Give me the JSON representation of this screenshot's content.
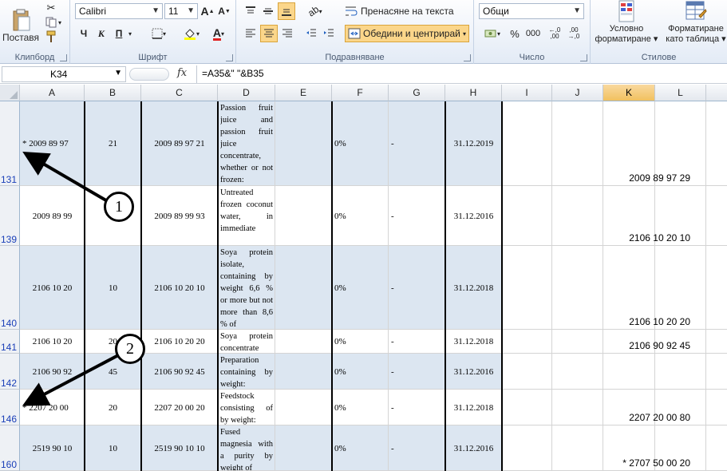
{
  "ribbon": {
    "clipboard": {
      "paste_label": "Поставя",
      "group_label": "Клипборд"
    },
    "font": {
      "name": "Calibri",
      "size": "11",
      "bold": "Ч",
      "italic": "К",
      "underline": "П",
      "group_label": "Шрифт"
    },
    "alignment": {
      "wrap_label": "Пренасяне на текста",
      "merge_label": "Обедини и центрирай",
      "group_label": "Подравняване"
    },
    "number": {
      "format": "Общи",
      "percent": "%",
      "thousands": "000",
      "group_label": "Число"
    },
    "styles": {
      "conditional_line1": "Условно",
      "conditional_line2": "форматиране",
      "table_line1": "Форматиране",
      "table_line2": "като таблица",
      "group_label": "Стилове"
    }
  },
  "formula_bar": {
    "cell_ref": "K34",
    "fx": "fx",
    "formula": "=A35&\" \"&B35"
  },
  "columns": [
    "A",
    "B",
    "C",
    "D",
    "E",
    "F",
    "G",
    "H",
    "I",
    "J",
    "K",
    "L"
  ],
  "rows": [
    {
      "num": "131",
      "a": "* 2009 89 97",
      "b": "21",
      "c": "2009 89 97 21",
      "d": "Passion fruit juice and passion fruit juice concentrate, whether or not frozen:",
      "f": "0%",
      "g": "-",
      "h": "31.12.2019",
      "k": "2009 89 97 29"
    },
    {
      "num": "139",
      "a": "2009 89 99",
      "b": "",
      "c": "2009 89 99 93",
      "d": "Untreated frozen coconut water, in immediate",
      "f": "0%",
      "g": "-",
      "h": "31.12.2016",
      "k": "2106 10 20 10"
    },
    {
      "num": "140",
      "a": "2106 10 20",
      "b": "10",
      "c": "2106 10 20 10",
      "d": "Soya protein isolate, containing by weight 6,6 % or more but not more than 8,6 % of",
      "f": "0%",
      "g": "-",
      "h": "31.12.2018",
      "k": "2106 10 20 20"
    },
    {
      "num": "141",
      "a": "2106 10 20",
      "b": "20",
      "c": "2106 10 20 20",
      "d": "Soya protein concentrate",
      "f": "0%",
      "g": "-",
      "h": "31.12.2018",
      "k": "2106 90 92 45"
    },
    {
      "num": "142",
      "a": "2106 90 92",
      "b": "45",
      "c": "2106 90 92 45",
      "d": "Preparation containing by weight:",
      "f": "0%",
      "g": "-",
      "h": "31.12.2016",
      "k": ""
    },
    {
      "num": "146",
      "a": "* 2207 20 00",
      "b": "20",
      "c": "2207 20 00 20",
      "d": " Feedstock consisting of by weight:",
      "f": "0%",
      "g": "-",
      "h": "31.12.2018",
      "k": "2207 20 00 80"
    },
    {
      "num": "160",
      "a": "2519 90 10",
      "b": "10",
      "c": "2519 90 10 10",
      "d": "Fused magnesia with a purity by weight of",
      "f": "0%",
      "g": "-",
      "h": "31.12.2016",
      "k": "* 2707 50 00 20"
    }
  ],
  "callouts": [
    "1",
    "2"
  ]
}
